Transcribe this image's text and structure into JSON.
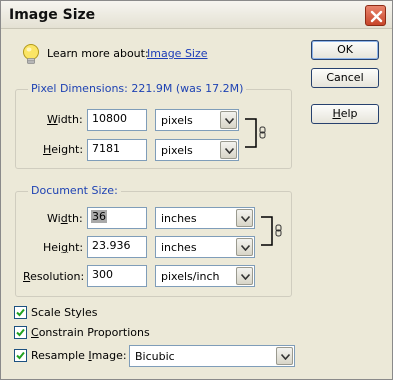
{
  "window": {
    "title": "Image Size"
  },
  "help_tip": {
    "text": "Learn more about:",
    "link": "Image Size"
  },
  "pixel_dimensions": {
    "legend": "Pixel Dimensions:",
    "size_text": "221.9M (was 17.2M)",
    "width_label": "Width:",
    "width_value": "10800",
    "width_unit": "pixels",
    "height_label": "Height:",
    "height_value": "7181",
    "height_unit": "pixels"
  },
  "document_size": {
    "legend": "Document Size:",
    "width_label": "Width:",
    "width_value": "36",
    "width_unit": "inches",
    "height_label": "Height:",
    "height_value": "23.936",
    "height_unit": "inches",
    "resolution_label": "Resolution:",
    "resolution_value": "300",
    "resolution_unit": "pixels/inch"
  },
  "options": {
    "scale_styles": {
      "label": "Scale Styles",
      "checked": true
    },
    "constrain_proportions": {
      "label": "Constrain Proportions",
      "checked": true
    },
    "resample_image": {
      "label": "Resample Image:",
      "checked": true,
      "method": "Bicubic"
    }
  },
  "buttons": {
    "ok": "OK",
    "cancel": "Cancel",
    "help": "Help"
  },
  "colors": {
    "dialog_bg": "#ece9d8",
    "legend_text": "#1f43b3",
    "link_text": "#1c3db8",
    "close_button": "#c7452a"
  },
  "icons": [
    "lightbulb-icon",
    "close-icon",
    "chain-link-icon",
    "checkmark-icon",
    "dropdown-arrow-icon"
  ]
}
